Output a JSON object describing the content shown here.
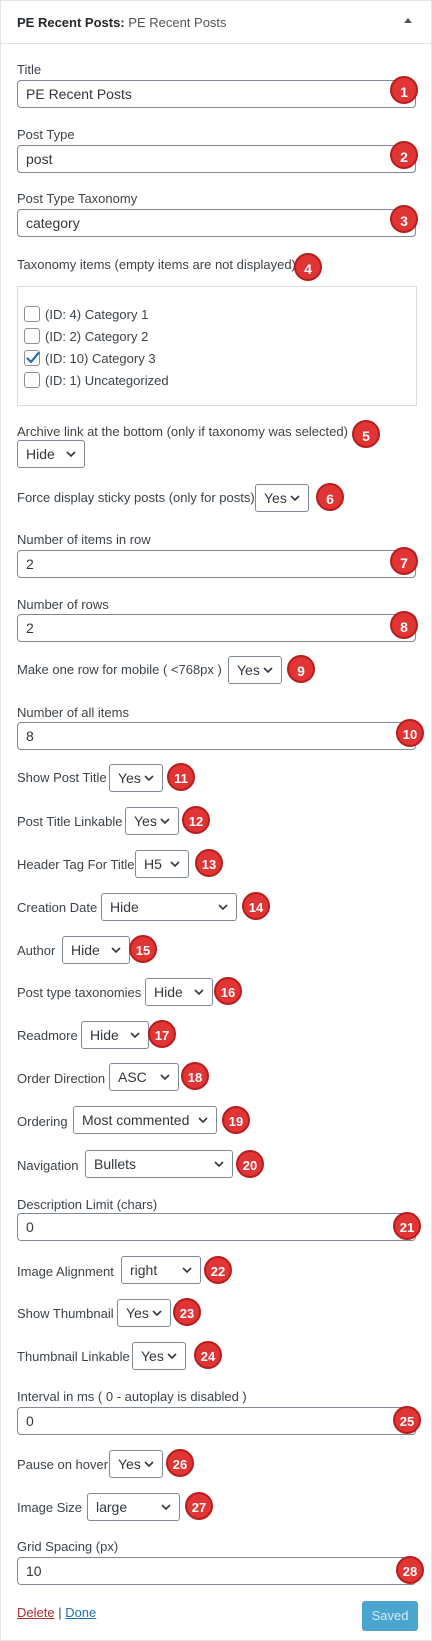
{
  "widget": {
    "title_bold": "PE Recent Posts:",
    "title_rest": " PE Recent Posts"
  },
  "fields": {
    "title": {
      "label": "Title",
      "value": "PE Recent Posts",
      "badge": "1"
    },
    "post_type": {
      "label": "Post Type",
      "value": "post",
      "badge": "2"
    },
    "post_type_taxonomy": {
      "label": "Post Type Taxonomy",
      "value": "category",
      "badge": "3"
    },
    "taxonomy_items": {
      "label": "Taxonomy items (empty items are not displayed)",
      "badge": "4",
      "items": [
        {
          "label": "(ID: 4) Category 1",
          "checked": false
        },
        {
          "label": "(ID: 2) Category 2",
          "checked": false
        },
        {
          "label": "(ID: 10) Category 3",
          "checked": true
        },
        {
          "label": "(ID: 1) Uncategorized",
          "checked": false
        }
      ]
    },
    "archive_link": {
      "label": "Archive link at the bottom (only if taxonomy was selected)",
      "value": "Hide",
      "badge": "5"
    },
    "force_sticky": {
      "label": "Force display sticky posts (only for posts)",
      "value": "Yes",
      "badge": "6"
    },
    "items_in_row": {
      "label": "Number of items in row",
      "value": "2",
      "badge": "7"
    },
    "rows": {
      "label": "Number of rows",
      "value": "2",
      "badge": "8"
    },
    "one_row_mobile": {
      "label": "Make one row for mobile ( <768px )",
      "value": "Yes",
      "badge": "9"
    },
    "all_items": {
      "label": "Number of all items",
      "value": "8",
      "badge": "10"
    },
    "show_post_title": {
      "label": "Show Post Title",
      "value": "Yes",
      "badge": "11"
    },
    "post_title_linkable": {
      "label": "Post Title Linkable",
      "value": "Yes",
      "badge": "12"
    },
    "header_tag": {
      "label": "Header Tag For Title",
      "value": "H5",
      "badge": "13"
    },
    "creation_date": {
      "label": "Creation Date",
      "value": "Hide",
      "badge": "14"
    },
    "author": {
      "label": "Author",
      "value": "Hide",
      "badge": "15"
    },
    "post_type_taxonomies": {
      "label": "Post type taxonomies",
      "value": "Hide",
      "badge": "16"
    },
    "readmore": {
      "label": "Readmore",
      "value": "Hide",
      "badge": "17"
    },
    "order_direction": {
      "label": "Order Direction",
      "value": "ASC",
      "badge": "18"
    },
    "ordering": {
      "label": "Ordering",
      "value": "Most commented",
      "badge": "19"
    },
    "navigation": {
      "label": "Navigation",
      "value": "Bullets",
      "badge": "20"
    },
    "description_limit": {
      "label": "Description Limit (chars)",
      "value": "0",
      "badge": "21"
    },
    "image_alignment": {
      "label": "Image Alignment",
      "value": "right",
      "badge": "22"
    },
    "show_thumbnail": {
      "label": "Show Thumbnail",
      "value": "Yes",
      "badge": "23"
    },
    "thumbnail_linkable": {
      "label": "Thumbnail Linkable",
      "value": "Yes",
      "badge": "24"
    },
    "interval": {
      "label": "Interval in ms ( 0 - autoplay is disabled )",
      "value": "0",
      "badge": "25"
    },
    "pause_hover": {
      "label": "Pause on hover",
      "value": "Yes",
      "badge": "26"
    },
    "image_size": {
      "label": "Image Size",
      "value": "large",
      "badge": "27"
    },
    "grid_spacing": {
      "label": "Grid Spacing (px)",
      "value": "10",
      "badge": "28"
    }
  },
  "footer": {
    "delete_label": "Delete",
    "separator": " | ",
    "done_label": "Done",
    "saved_label": "Saved"
  },
  "colors": {
    "badge": "#e13434",
    "saved_button": "#4aa5cf",
    "delete_link": "#b32d2e",
    "done_link": "#2271b1"
  }
}
